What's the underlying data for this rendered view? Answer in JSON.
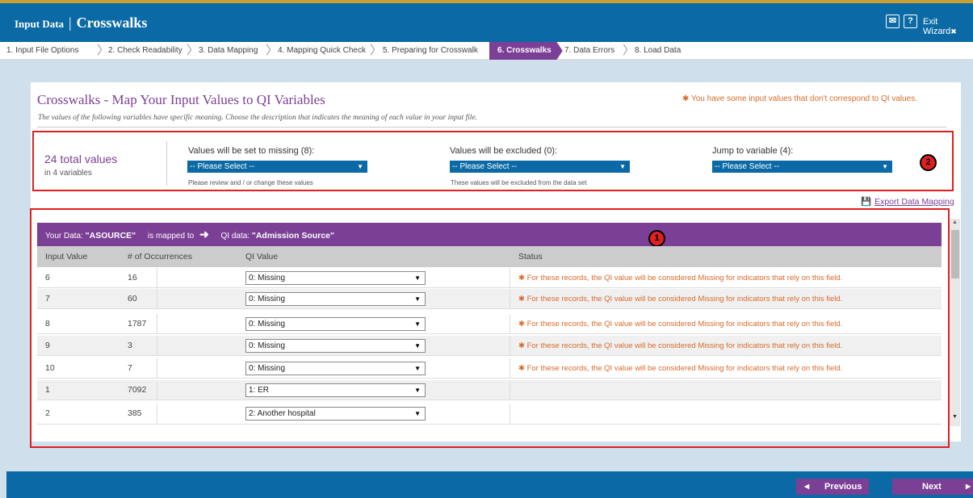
{
  "header": {
    "title_small": "Input Data",
    "title_sep": "|",
    "title_big": "Crosswalks",
    "mail_glyph": "✉",
    "help_glyph": "?",
    "exit_label": "Exit Wizard",
    "exit_x": "✖"
  },
  "steps": [
    {
      "label": "1. Input File Options"
    },
    {
      "label": "2. Check Readability"
    },
    {
      "label": "3. Data Mapping"
    },
    {
      "label": "4. Mapping Quick Check"
    },
    {
      "label": "5. Preparing for Crosswalk"
    },
    {
      "label": "6. Crosswalks",
      "active": true
    },
    {
      "label": "7. Data Errors"
    },
    {
      "label": "8. Load Data"
    }
  ],
  "main": {
    "title": "Crosswalks - Map Your Input Values to QI Variables",
    "warning": "✱ You have some input values that don't correspond to QI values.",
    "description": "The values of the following variables have specific meaning. Choose the description that indicates the meaning of each value in your input file."
  },
  "summary": {
    "total": "24 total values",
    "sub": "in 4 variables",
    "missing_label": "Values will be set to missing (8):",
    "missing_value": "-- Please Select --",
    "missing_note": "Please review and / or change these values",
    "excluded_label": "Values will be excluded (0):",
    "excluded_value": "-- Please Select --",
    "excluded_note": "These values will be excluded from the data set",
    "jump_label": "Jump to variable (4):",
    "jump_value": "-- Please Select --"
  },
  "annotations": {
    "one": "1",
    "two": "2"
  },
  "export_label": "Export Data Mapping",
  "grid": {
    "your_data_label": "Your Data:",
    "your_data_value": "\"ASOURCE\"",
    "mapped_to": "is mapped to",
    "qi_data_label": "QI data:",
    "qi_data_value": "\"Admission Source\"",
    "columns": [
      "Input Value",
      "# of Occurrences",
      "QI Value",
      "Status"
    ],
    "rows": [
      {
        "input": "6",
        "occ": "16",
        "qi": "0: Missing",
        "status": "✱ For these records, the QI value will be considered Missing for indicators that rely on this field."
      },
      {
        "input": "7",
        "occ": "60",
        "qi": "0: Missing",
        "status": "✱ For these records, the QI value will be considered Missing for indicators that rely on this field."
      },
      {
        "input": "8",
        "occ": "1787",
        "qi": "0: Missing",
        "status": "✱ For these records, the QI value will be considered Missing for indicators that rely on this field."
      },
      {
        "input": "9",
        "occ": "3",
        "qi": "0: Missing",
        "status": "✱ For these records, the QI value will be considered Missing for indicators that rely on this field."
      },
      {
        "input": "10",
        "occ": "7",
        "qi": "0: Missing",
        "status": "✱ For these records, the QI value will be considered Missing for indicators that rely on this field."
      },
      {
        "input": "1",
        "occ": "7092",
        "qi": "1: ER",
        "status": ""
      },
      {
        "input": "2",
        "occ": "385",
        "qi": "2: Another hospital",
        "status": ""
      }
    ]
  },
  "footer": {
    "previous_label": "Previous",
    "next_label": "Next"
  },
  "colors": {
    "brand_blue": "#0b6aa5",
    "purple": "#7b3f96",
    "warning_orange": "#d86b2b",
    "annotation_red": "#e02020"
  }
}
